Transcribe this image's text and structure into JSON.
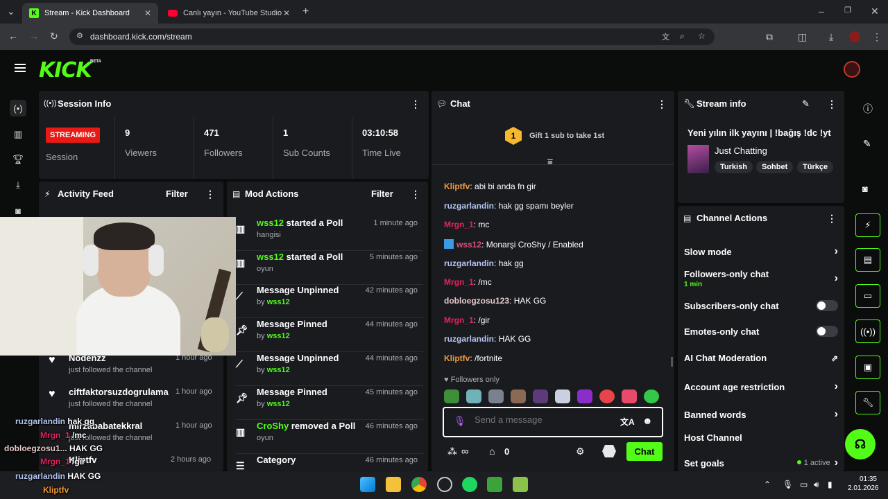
{
  "browser": {
    "tabs": [
      {
        "title": "Stream - Kick Dashboard"
      },
      {
        "title": "Canlı yayın - YouTube Studio"
      }
    ],
    "url": "dashboard.kick.com/stream"
  },
  "header": {
    "logo": "KICK",
    "beta": "BETA"
  },
  "session": {
    "title": "Session Info",
    "badge": "STREAMING",
    "label": "Session",
    "stats": [
      {
        "value": "9",
        "label": "Viewers"
      },
      {
        "value": "471",
        "label": "Followers"
      },
      {
        "value": "1",
        "label": "Sub Counts"
      },
      {
        "value": "03:10:58",
        "label": "Time Live"
      }
    ]
  },
  "activity": {
    "title": "Activity Feed",
    "filter": "Filter",
    "items": [
      {
        "user": "Nodenzz",
        "text": "just followed the channel",
        "time": "1 hour ago"
      },
      {
        "user": "ciftfaktorsuzdogrulama",
        "text": "just followed the channel",
        "time": "1 hour ago"
      },
      {
        "user": "mirzababatekkral",
        "text": "just followed the channel",
        "time": "1 hour ago"
      },
      {
        "user": "Kliptfv",
        "text": "",
        "time": "2 hours ago"
      }
    ]
  },
  "mod": {
    "title": "Mod Actions",
    "filter": "Filter",
    "items": [
      {
        "user": "wss12",
        "action": "started a Poll",
        "sub": "hangisi",
        "subuser": "",
        "time": "1 minute ago"
      },
      {
        "user": "wss12",
        "action": "started a Poll",
        "sub": "oyun",
        "subuser": "",
        "time": "5 minutes ago"
      },
      {
        "user": "",
        "action": "Message Unpinned",
        "sub": "by",
        "subuser": "wss12",
        "time": "42 minutes ago"
      },
      {
        "user": "",
        "action": "Message Pinned",
        "sub": "by",
        "subuser": "wss12",
        "time": "44 minutes ago"
      },
      {
        "user": "",
        "action": "Message Unpinned",
        "sub": "by",
        "subuser": "wss12",
        "time": "44 minutes ago"
      },
      {
        "user": "",
        "action": "Message Pinned",
        "sub": "by",
        "subuser": "wss12",
        "time": "45 minutes ago"
      },
      {
        "user": "CroShy",
        "action": "removed a Poll",
        "sub": "oyun",
        "subuser": "",
        "time": "46 minutes ago"
      },
      {
        "user": "",
        "action": "Category",
        "sub": "",
        "subuser": "",
        "time": "46 minutes ago"
      }
    ]
  },
  "chat": {
    "title": "Chat",
    "gift_count": "1",
    "gift": "Gift 1 sub to take 1st",
    "messages": [
      {
        "user": "Kliptfv",
        "text": "abi bi anda fn gir",
        "color": "#f29c38"
      },
      {
        "user": "ruzgarlandin",
        "text": "hak gg spamı beyler",
        "color": "#b4c5f0"
      },
      {
        "user": "Mrgn_1",
        "text": "mc",
        "color": "#e0245e"
      },
      {
        "user": "wss12",
        "text": "Monarşi CroShy / Enabled",
        "color": "#e14f7e"
      },
      {
        "user": "ruzgarlandin",
        "text": "hak gg",
        "color": "#b4c5f0"
      },
      {
        "user": "Mrgn_1",
        "text": "/mc",
        "color": "#e0245e"
      },
      {
        "user": "dobloegzosu123",
        "text": "HAK GG",
        "color": "#e8c9c9"
      },
      {
        "user": "Mrgn_1",
        "text": "/gir",
        "color": "#e0245e"
      },
      {
        "user": "ruzgarlandin",
        "text": "HAK GG",
        "color": "#b4c5f0"
      },
      {
        "user": "Kliptfv",
        "text": "/fortnite",
        "color": "#f29c38"
      }
    ],
    "followers_only": "Followers only",
    "placeholder": "Send a message",
    "count": "0",
    "send": "Chat"
  },
  "stream_info": {
    "title": "Stream info",
    "stream_title": "Yeni yılın ilk yayını | !bağış !dc !yt",
    "category": "Just Chatting",
    "tags": [
      "Turkish",
      "Sohbet",
      "Türkçe"
    ]
  },
  "channel_actions": {
    "title": "Channel Actions",
    "slow": "Slow mode",
    "followers": "Followers-only chat",
    "followers_sub": "1 min",
    "subs": "Subscribers-only chat",
    "emotes": "Emotes-only chat",
    "ai": "AI Chat Moderation",
    "age": "Account age restriction",
    "banned": "Banned words",
    "host": "Host Channel",
    "goals": "Set goals",
    "goals_status": "1 active"
  },
  "overlay_chat": [
    {
      "user": "ruzgarlandin",
      "text": "hak gg"
    },
    {
      "user": "Mrgn_1",
      "text": "/mc"
    },
    {
      "user": "dobloegzosu1...",
      "text": "HAK GG"
    },
    {
      "user": "Mrgn_1",
      "text": "/gir"
    },
    {
      "user": "ruzgarlandin",
      "text": "HAK GG"
    },
    {
      "user": "Kliptfv",
      "text": ""
    }
  ],
  "taskbar": {
    "time": "01:35",
    "date": "2.01.2026"
  },
  "colors": {
    "accent": "#53fc18",
    "panel": "#191b1f",
    "bg": "#0b0d0c",
    "live": "#e91916"
  }
}
